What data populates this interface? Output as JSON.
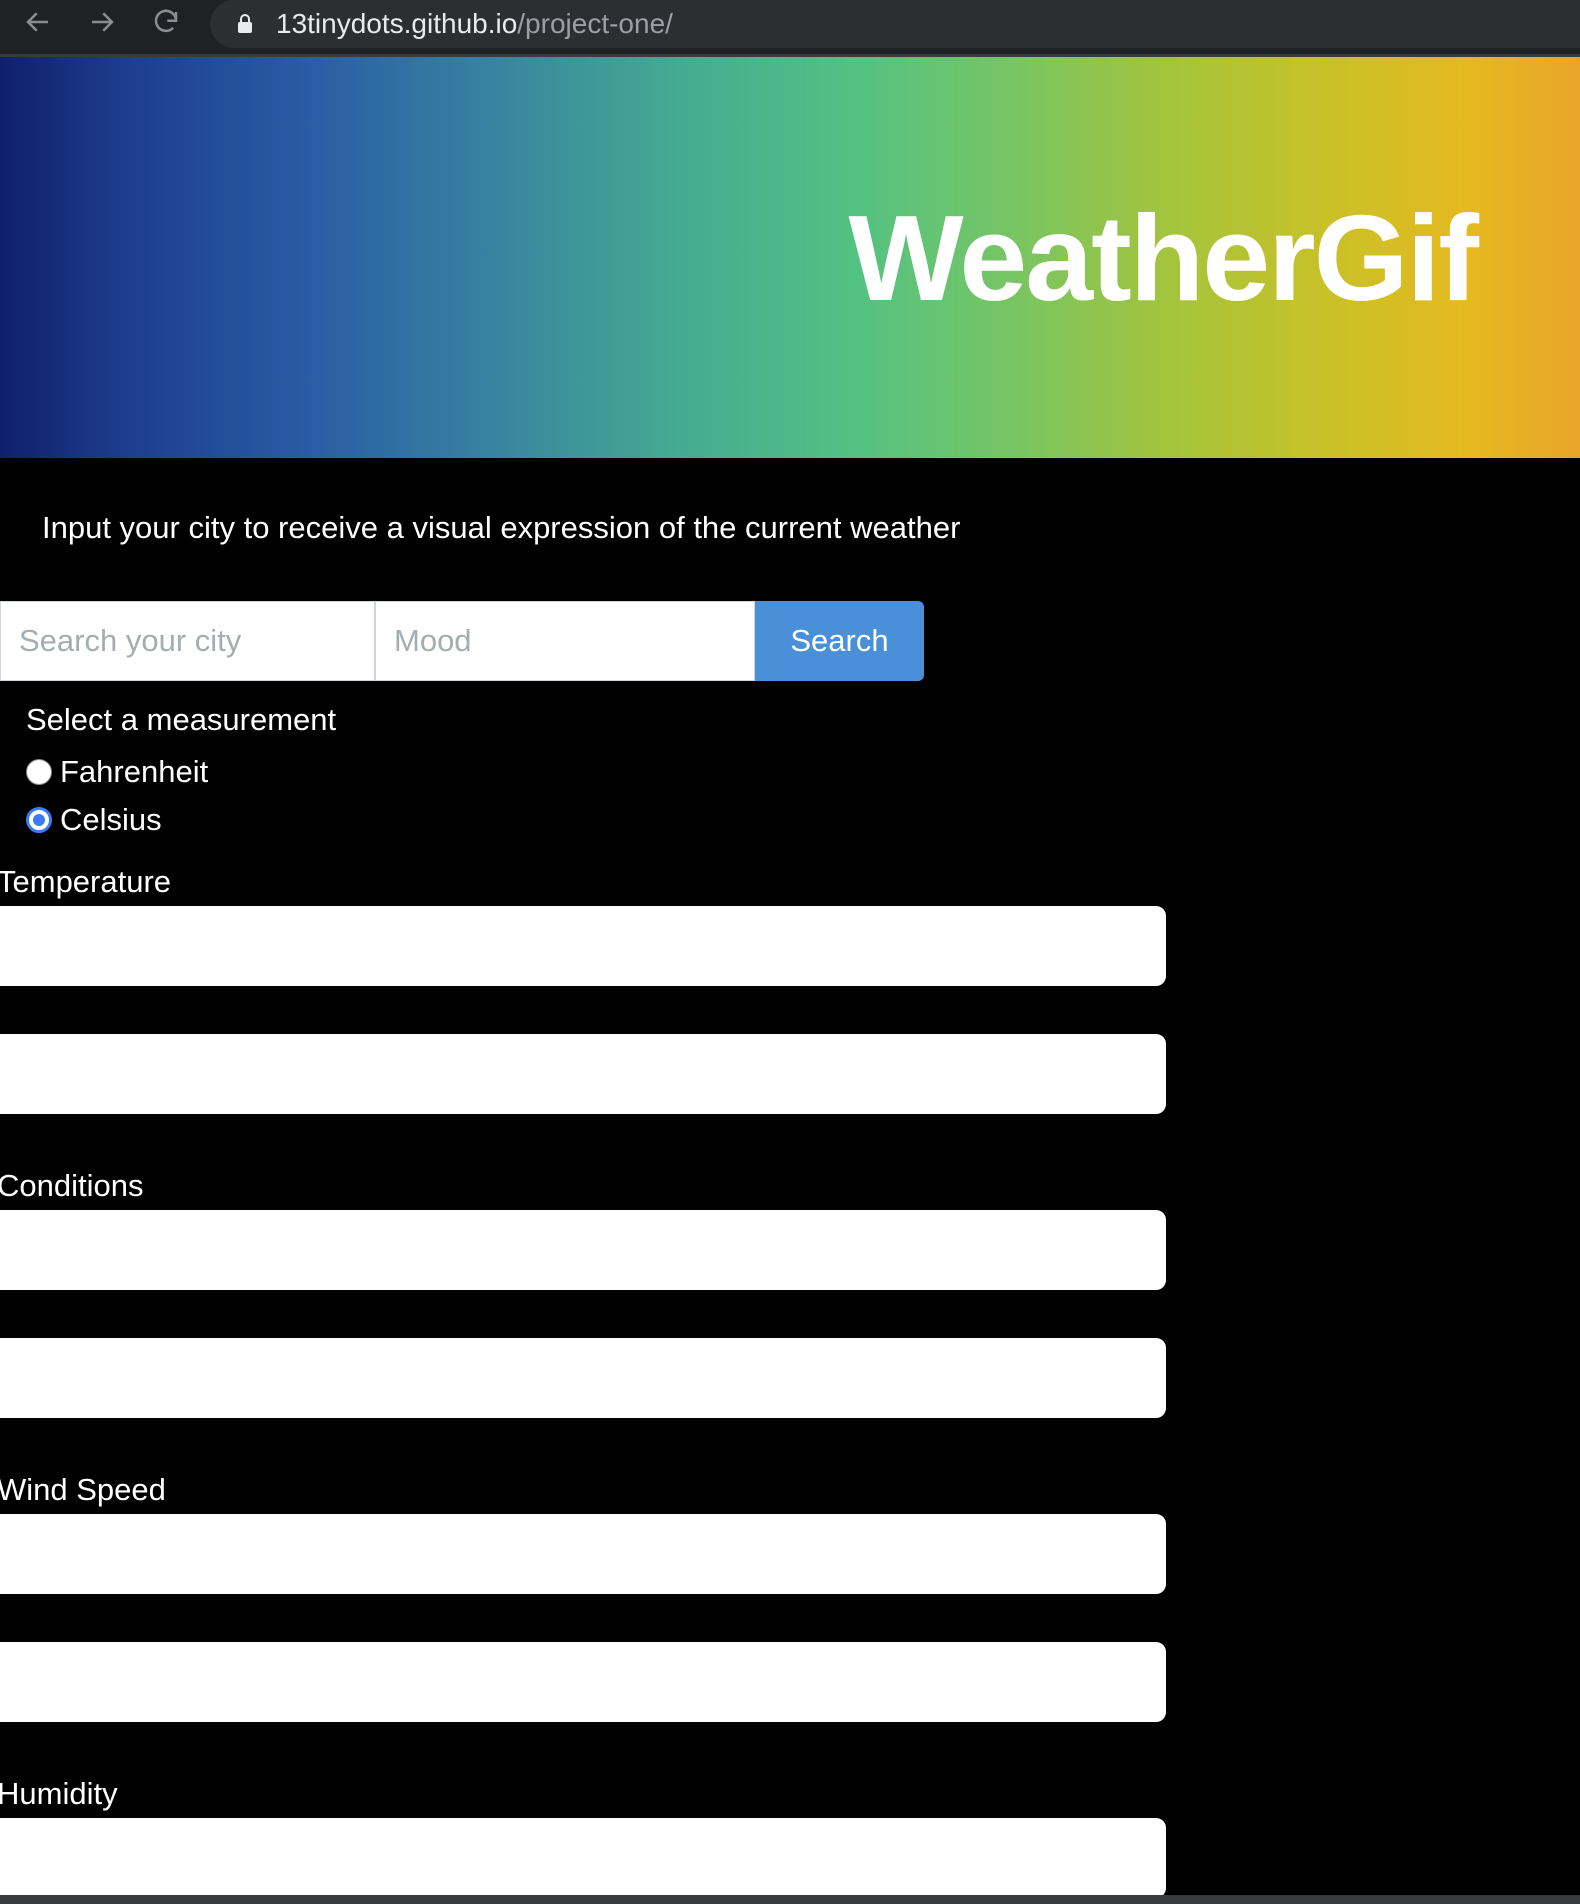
{
  "browser": {
    "url_host": "13tinydots.github.io",
    "url_path": "/project-one/"
  },
  "header": {
    "title": "WeatherGif"
  },
  "intro": {
    "text": "Input your city to receive a visual expression of the current weather"
  },
  "search": {
    "city_placeholder": "Search your city",
    "city_value": "",
    "mood_placeholder": "Mood",
    "mood_value": "",
    "button_label": "Search"
  },
  "measurement": {
    "title": "Select a measurement",
    "options": [
      {
        "label": "Fahrenheit",
        "checked": false
      },
      {
        "label": "Celsius",
        "checked": true
      }
    ]
  },
  "sections": {
    "temperature": {
      "label": "Temperature"
    },
    "conditions": {
      "label": "Conditions"
    },
    "wind_speed": {
      "label": "Wind Speed"
    },
    "humidity": {
      "label": "Humidity"
    }
  },
  "colors": {
    "accent": "#4a90d9",
    "radio_checked": "#3b7bf6",
    "background": "#000000"
  }
}
